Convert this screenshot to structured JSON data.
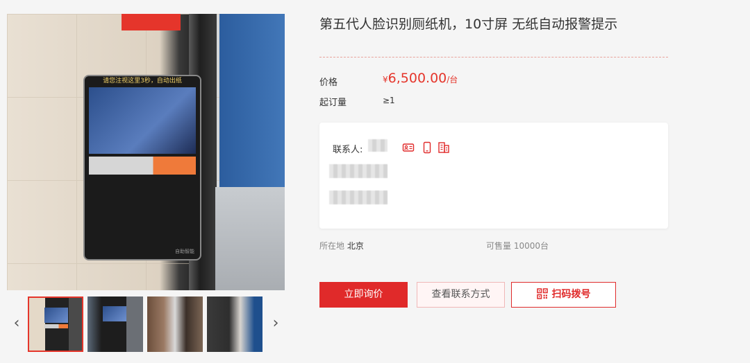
{
  "product": {
    "title": "第五代人脸识别厕纸机，10寸屏 无纸自动报警提示",
    "price_label": "价格",
    "price_currency": "¥",
    "price_amount": "6,500.00",
    "price_unit": "/台",
    "moq_label": "起订量",
    "moq_value": "≥1"
  },
  "gallery": {
    "device_caption": "请您注视这里3秒，自动出纸",
    "device_brand": "自助智能",
    "prev_arrow": "‹",
    "next_arrow": "›",
    "thumbnails": [
      "thumb-1",
      "thumb-2",
      "thumb-3",
      "thumb-4"
    ]
  },
  "contact": {
    "label": "联系人:",
    "icons": [
      "business-card-icon",
      "mobile-phone-icon",
      "building-icon"
    ]
  },
  "meta": {
    "location_label": "所在地",
    "location_value": "北京",
    "stock_label": "可售量",
    "stock_value": "10000台"
  },
  "actions": {
    "inquire": "立即询价",
    "view_contact": "查看联系方式",
    "scan_dial": "扫码拨号"
  },
  "colors": {
    "accent": "#e02a2a",
    "price": "#e5352b",
    "background": "#f5f5f5"
  }
}
